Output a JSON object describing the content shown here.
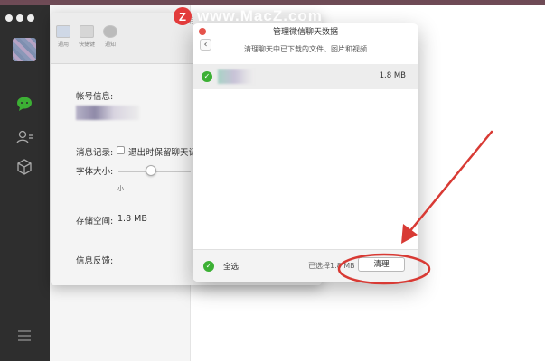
{
  "watermark": {
    "logo_letter": "Z",
    "text": "www.MacZ.com"
  },
  "sidebar": {
    "icons": [
      "chat-icon",
      "contacts-icon",
      "favorites-icon",
      "menu-icon"
    ]
  },
  "settings": {
    "title": "通用",
    "toolbar": [
      {
        "label": "通用",
        "active": true
      },
      {
        "label": "快捷键",
        "active": false
      },
      {
        "label": "通知",
        "active": false
      }
    ],
    "account_label": "帐号信息:",
    "messages_label": "消息记录:",
    "messages_option": "退出时保留聊天记录",
    "font_label": "字体大小:",
    "font_small": "小",
    "storage_label": "存储空间:",
    "storage_value": "1.8 MB",
    "feedback_label": "信息反馈:"
  },
  "dialog": {
    "title": "管理微信聊天数据",
    "subtitle": "清理聊天中已下载的文件、图片和视频",
    "items": [
      {
        "size": "1.8 MB",
        "checked": true
      }
    ],
    "footer": {
      "select_all": "全选",
      "selected_text": "已选择1.8 MB",
      "clear_button": "清理"
    }
  },
  "colors": {
    "accent_green": "#3cb034",
    "close_red": "#e5534b",
    "annotation_red": "#d83a34"
  }
}
